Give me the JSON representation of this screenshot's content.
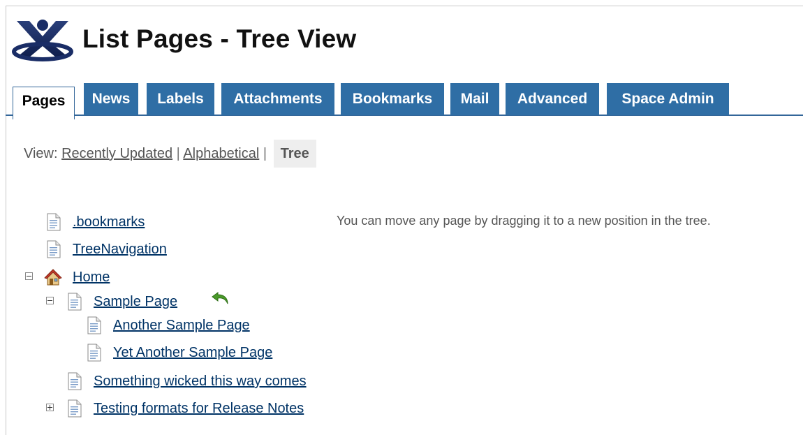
{
  "header": {
    "title": "List Pages - Tree View",
    "logo_icon": "confluence-logo-icon"
  },
  "colors": {
    "tab_bg": "#2f6ea5",
    "tab_text": "#ffffff",
    "link": "#003366",
    "accent_line": "#336699",
    "undo_green": "#4a9a2a"
  },
  "tabs": [
    {
      "label": "Pages",
      "active": true
    },
    {
      "label": "News",
      "active": false
    },
    {
      "label": "Labels",
      "active": false
    },
    {
      "label": "Attachments",
      "active": false
    },
    {
      "label": "Bookmarks",
      "active": false
    },
    {
      "label": "Mail",
      "active": false
    },
    {
      "label": "Advanced",
      "active": false
    },
    {
      "label": "Space Admin",
      "active": false
    }
  ],
  "view": {
    "prefix": "View:",
    "options": [
      "Recently Updated",
      "Alphabetical"
    ],
    "separator": "|",
    "current": "Tree"
  },
  "hint": "You can move any page by dragging it to a new position in the tree.",
  "tree": [
    {
      "label": ".bookmarks",
      "icon": "document-icon",
      "toggle": null
    },
    {
      "label": "TreeNavigation",
      "icon": "document-icon",
      "toggle": null
    },
    {
      "label": "Home",
      "icon": "home-icon",
      "toggle": "collapse"
    },
    {
      "label": "Sample Page",
      "icon": "document-icon",
      "toggle": "collapse",
      "action_icon": "undo-icon"
    },
    {
      "label": "Another Sample Page",
      "icon": "document-icon",
      "toggle": null
    },
    {
      "label": "Yet Another Sample Page",
      "icon": "document-icon",
      "toggle": null
    },
    {
      "label": "Something wicked this way comes",
      "icon": "document-icon",
      "toggle": null
    },
    {
      "label": "Testing formats for Release Notes",
      "icon": "document-icon",
      "toggle": "expand"
    }
  ]
}
